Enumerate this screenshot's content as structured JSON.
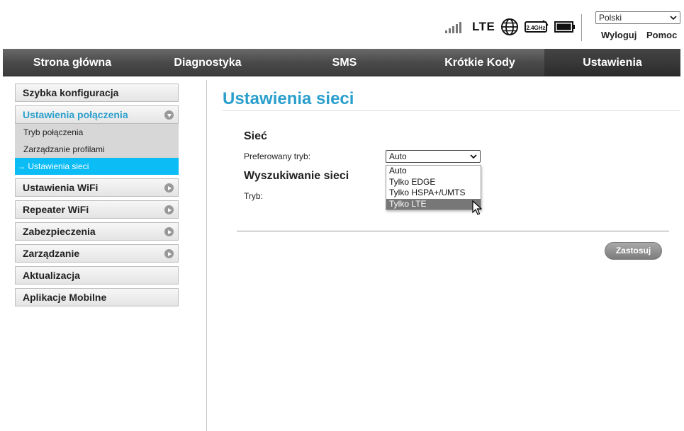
{
  "header": {
    "status": {
      "network_type": "LTE",
      "signal_icon": "signal-bars-icon",
      "globe_icon": "globe-icon",
      "wifi_icon": "wifi-24ghz-icon",
      "wifi_badge": "2.4GHz",
      "battery_icon": "battery-icon"
    },
    "language": {
      "selected": "Polski"
    },
    "links": {
      "logout": "Wyloguj",
      "help": "Pomoc"
    }
  },
  "nav": {
    "tabs": [
      {
        "label": "Strona główna"
      },
      {
        "label": "Diagnostyka"
      },
      {
        "label": "SMS"
      },
      {
        "label": "Krótkie Kody"
      },
      {
        "label": "Ustawienia",
        "active": true
      }
    ]
  },
  "sidebar": {
    "items": [
      {
        "label": "Szybka konfiguracja"
      },
      {
        "label": "Ustawienia połączenia",
        "expanded": true,
        "sub": [
          {
            "label": "Tryb połączenia"
          },
          {
            "label": "Zarządzanie profilami"
          },
          {
            "label": "→ Ustawienia sieci",
            "active": true
          }
        ]
      },
      {
        "label": "Ustawienia WiFi"
      },
      {
        "label": "Repeater WiFi"
      },
      {
        "label": "Zabezpieczenia"
      },
      {
        "label": "Zarządzanie"
      },
      {
        "label": "Aktualizacja"
      },
      {
        "label": "Aplikacje Mobilne"
      }
    ]
  },
  "main": {
    "title": "Ustawienia sieci",
    "network_section": {
      "heading": "Sieć",
      "preferred_mode_label": "Preferowany tryb:",
      "preferred_mode_value": "Auto",
      "options": [
        "Auto",
        "Tylko EDGE",
        "Tylko HSPA+/UMTS",
        "Tylko LTE"
      ],
      "highlighted_option": "Tylko LTE"
    },
    "search_section": {
      "heading": "Wyszukiwanie sieci",
      "mode_label": "Tryb:"
    },
    "apply_label": "Zastosuj"
  },
  "colors": {
    "accent": "#2b9fcc",
    "active_sub": "#0bbcf5",
    "nav_bg": "#4a4a4a"
  }
}
